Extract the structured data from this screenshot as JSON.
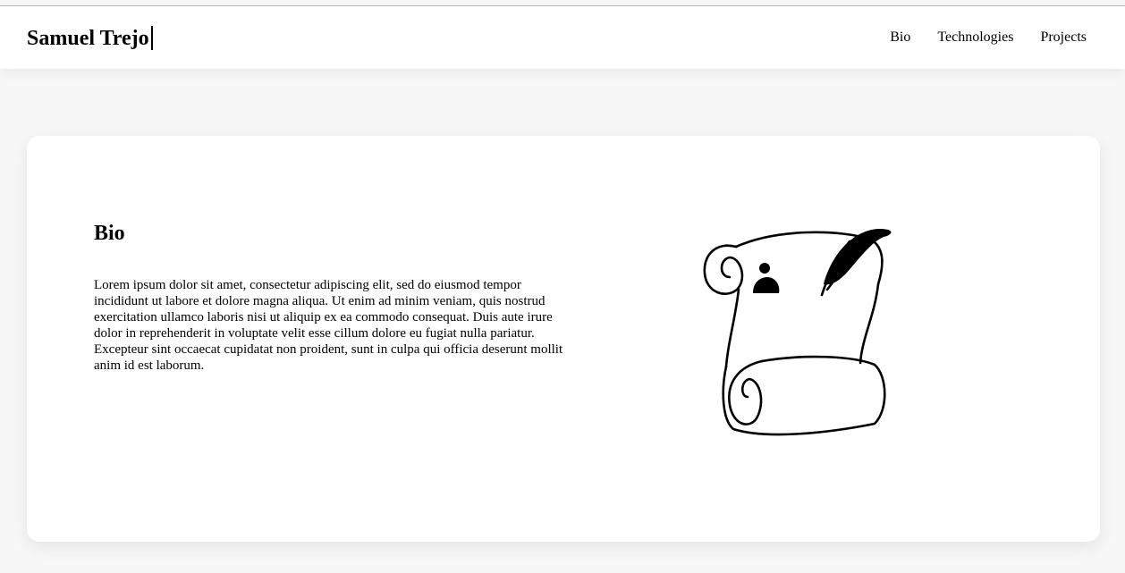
{
  "header": {
    "brand": "Samuel Trejo",
    "nav": [
      {
        "label": "Bio"
      },
      {
        "label": "Technologies"
      },
      {
        "label": "Projects"
      }
    ]
  },
  "bio": {
    "title": "Bio",
    "text": "Lorem ipsum dolor sit amet, consectetur adipiscing elit, sed do eiusmod tempor incididunt ut labore et dolore magna aliqua. Ut enim ad minim veniam, quis nostrud exercitation ullamco laboris nisi ut aliquip ex ea commodo consequat. Duis aute irure dolor in reprehenderit in voluptate velit esse cillum dolore eu fugiat nulla pariatur. Excepteur sint occaecat cupidatat non proident, sunt in culpa qui officia deserunt mollit anim id est laborum.",
    "illustration_icon": "scroll-quill-icon"
  }
}
